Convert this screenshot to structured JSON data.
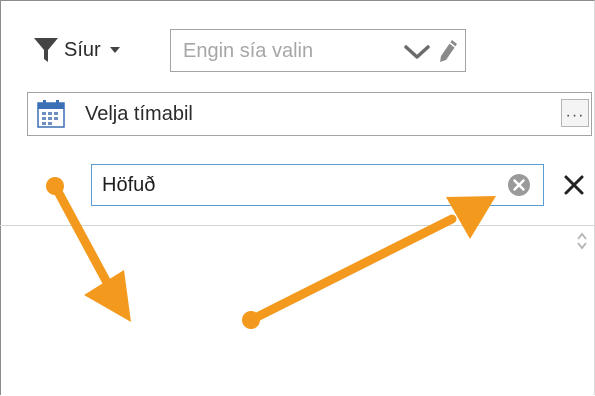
{
  "filter": {
    "button_label": "Síur",
    "select_placeholder": "Engin sía valin"
  },
  "period": {
    "label": "Velja tímabil",
    "more_label": "···"
  },
  "search": {
    "value": "Höfuð"
  },
  "colors": {
    "accent_arrow": "#f39a1e",
    "search_border": "#5b9bd5",
    "text": "#2b2b2b",
    "placeholder": "#a6a6a6"
  },
  "icons": [
    "funnel-icon",
    "caret-down-icon",
    "chevron-down-icon",
    "pencil-icon",
    "calendar-icon",
    "clear-circle-icon",
    "close-icon",
    "scroll-arrows-icon"
  ]
}
